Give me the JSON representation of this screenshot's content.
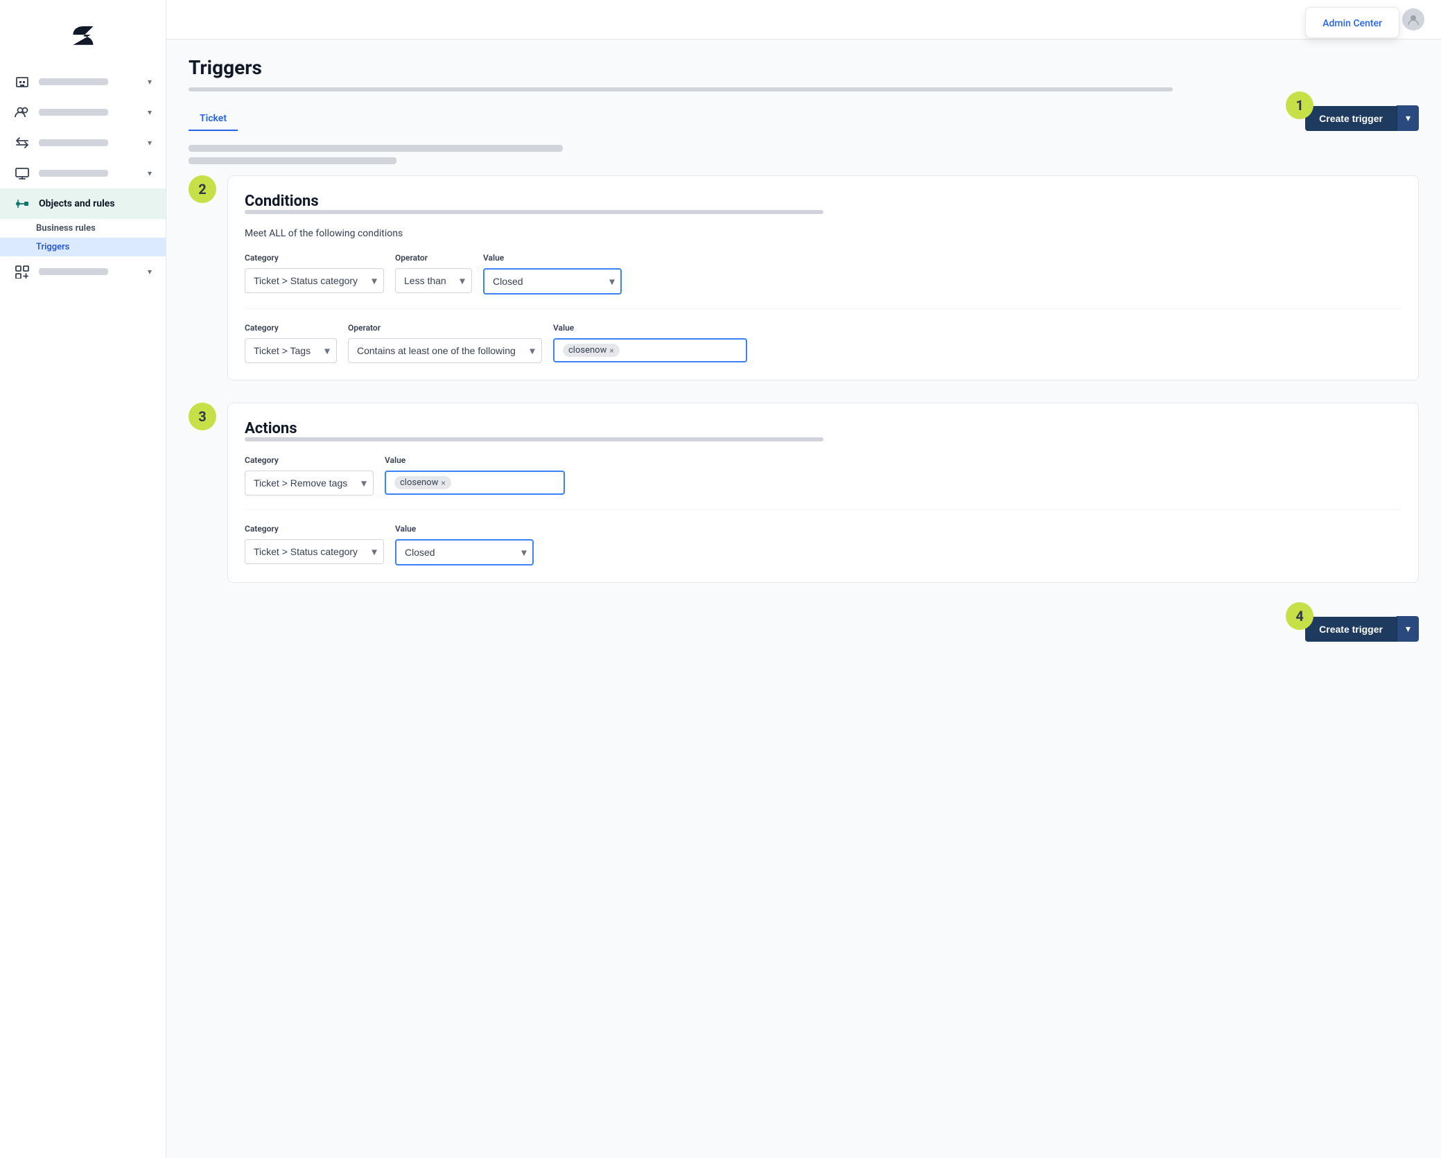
{
  "sidebar": {
    "logo_alt": "Zendesk Logo",
    "nav_items": [
      {
        "id": "workspace",
        "label": "",
        "active": false
      },
      {
        "id": "people",
        "label": "",
        "active": false
      },
      {
        "id": "channels",
        "label": "",
        "active": false
      },
      {
        "id": "workspace2",
        "label": "",
        "active": false
      },
      {
        "id": "objects",
        "label": "Objects and rules",
        "active": true
      },
      {
        "id": "apps",
        "label": "",
        "active": false
      }
    ],
    "sub_items": [
      {
        "id": "business-rules",
        "label": "Business rules",
        "active": false
      },
      {
        "id": "triggers",
        "label": "Triggers",
        "active": true
      }
    ]
  },
  "header": {
    "admin_center_label": "Admin Center"
  },
  "page": {
    "title": "Triggers",
    "tabs": [
      {
        "id": "ticket",
        "label": "Ticket",
        "active": true
      }
    ],
    "create_trigger_label": "Create trigger",
    "create_trigger_chevron": "▾"
  },
  "step_badges": {
    "step1": "1",
    "step2": "2",
    "step3": "3",
    "step4": "4"
  },
  "conditions": {
    "section_title": "Conditions",
    "subtitle": "Meet ALL of the following conditions",
    "rows": [
      {
        "category_label": "Category",
        "category_value": "Ticket > Status category",
        "operator_label": "Operator",
        "operator_value": "Less than",
        "value_label": "Value",
        "value_value": "Closed"
      },
      {
        "category_label": "Category",
        "category_value": "Ticket > Tags",
        "operator_label": "Operator",
        "operator_value": "Contains at least one of the following",
        "value_label": "Value",
        "tag": "closenow"
      }
    ]
  },
  "actions": {
    "section_title": "Actions",
    "rows": [
      {
        "category_label": "Category",
        "category_value": "Ticket > Remove tags",
        "value_label": "Value",
        "tag": "closenow"
      },
      {
        "category_label": "Category",
        "category_value": "Ticket > Status category",
        "value_label": "Value",
        "value_value": "Closed"
      }
    ]
  }
}
